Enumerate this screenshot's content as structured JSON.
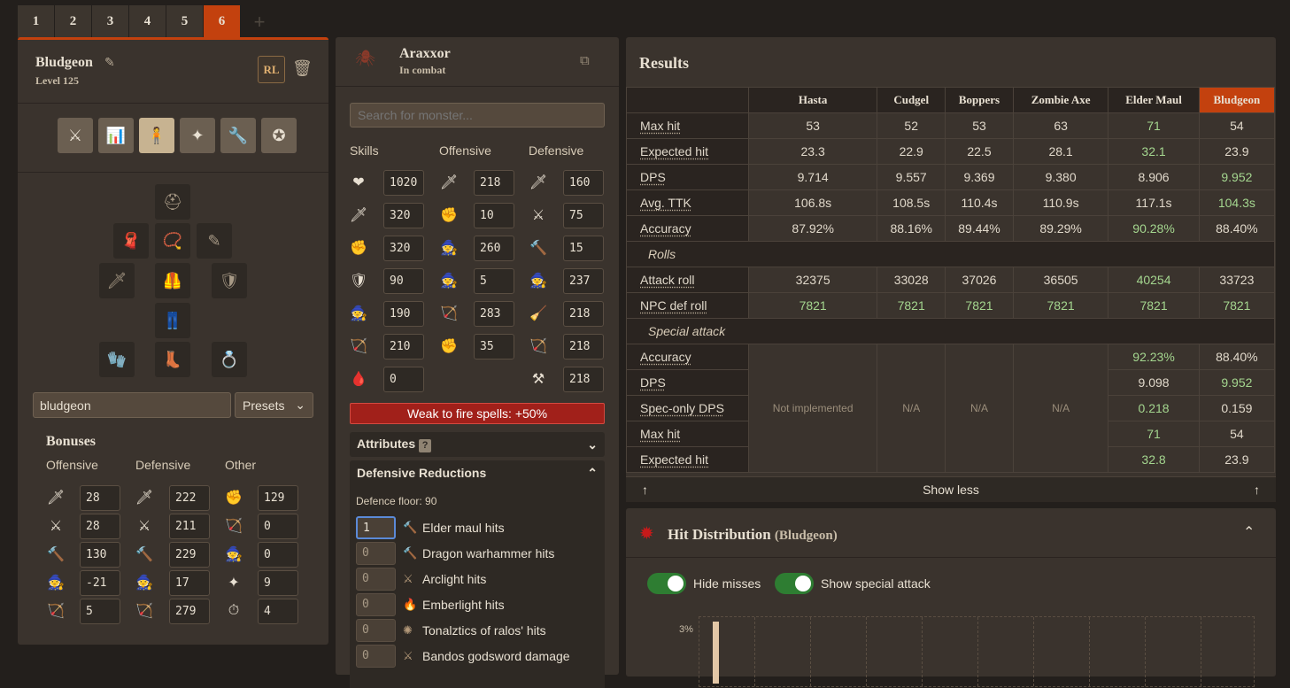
{
  "tabs": [
    "1",
    "2",
    "3",
    "4",
    "5",
    "6"
  ],
  "active_tab": "6",
  "tab_add": "+",
  "loadout": {
    "name": "Bludgeon",
    "level": "Level 125",
    "rl_label": "RL",
    "icons": [
      "combat-styles-icon",
      "skills-icon",
      "equipment-icon",
      "prayer-icon",
      "spanner-icon",
      "spellbook-icon"
    ],
    "search_value": "bludgeon",
    "presets_label": "Presets"
  },
  "bonuses": {
    "title": "Bonuses",
    "offensive_label": "Offensive",
    "defensive_label": "Defensive",
    "other_label": "Other",
    "offensive": [
      "28",
      "28",
      "130",
      "-21",
      "5"
    ],
    "defensive": [
      "222",
      "211",
      "229",
      "17",
      "279"
    ],
    "other": [
      "129",
      "0",
      "0",
      "9",
      "4"
    ]
  },
  "monster": {
    "name": "Araxxor",
    "status": "In combat",
    "search_placeholder": "Search for monster...",
    "skills_label": "Skills",
    "offensive_label": "Offensive",
    "defensive_label": "Defensive",
    "skills": [
      "1020",
      "320",
      "320",
      "90",
      "190",
      "210",
      "0"
    ],
    "offensive": [
      "218",
      "10",
      "260",
      "5",
      "283",
      "35"
    ],
    "defensive": [
      "160",
      "75",
      "15",
      "237",
      "218",
      "218",
      "218"
    ],
    "weakness": "Weak to fire spells: +50%",
    "attributes_label": "Attributes",
    "attributes_q": "?",
    "defred_label": "Defensive Reductions",
    "defence_floor": "Defence floor: 90",
    "reductions": [
      {
        "value": "1",
        "label": "Elder maul hits"
      },
      {
        "value": "0",
        "label": "Dragon warhammer hits"
      },
      {
        "value": "0",
        "label": "Arclight hits"
      },
      {
        "value": "0",
        "label": "Emberlight hits"
      },
      {
        "value": "0",
        "label": "Tonalztics of ralos' hits"
      },
      {
        "value": "0",
        "label": "Bandos godsword damage"
      }
    ]
  },
  "results": {
    "title": "Results",
    "columns": [
      "Hasta",
      "Cudgel",
      "Boppers",
      "Zombie Axe",
      "Elder Maul",
      "Bludgeon"
    ],
    "rows": [
      {
        "label": "Max hit",
        "values": [
          "53",
          "52",
          "53",
          "63",
          "71",
          "54"
        ]
      },
      {
        "label": "Expected hit",
        "values": [
          "23.3",
          "22.9",
          "22.5",
          "28.1",
          "32.1",
          "23.9"
        ]
      },
      {
        "label": "DPS",
        "values": [
          "9.714",
          "9.557",
          "9.369",
          "9.380",
          "8.906",
          "9.952"
        ]
      },
      {
        "label": "Avg. TTK",
        "values": [
          "106.8s",
          "108.5s",
          "110.4s",
          "110.9s",
          "117.1s",
          "104.3s"
        ]
      },
      {
        "label": "Accuracy",
        "values": [
          "87.92%",
          "88.16%",
          "89.44%",
          "89.29%",
          "90.28%",
          "88.40%"
        ]
      }
    ],
    "rolls_label": "Rolls",
    "roll_rows": [
      {
        "label": "Attack roll",
        "values": [
          "32375",
          "33028",
          "37026",
          "36505",
          "40254",
          "33723"
        ]
      },
      {
        "label": "NPC def roll",
        "values": [
          "7821",
          "7821",
          "7821",
          "7821",
          "7821",
          "7821"
        ]
      }
    ],
    "spec_label": "Special attack",
    "spec_rows": [
      {
        "label": "Accuracy",
        "values": [
          "92.23%",
          "88.40%"
        ]
      },
      {
        "label": "DPS",
        "values": [
          "9.098",
          "9.952"
        ]
      },
      {
        "label": "Spec-only DPS",
        "values": [
          "0.218",
          "0.159"
        ]
      },
      {
        "label": "Max hit",
        "values": [
          "71",
          "54"
        ]
      },
      {
        "label": "Expected hit",
        "values": [
          "32.8",
          "23.9"
        ]
      }
    ],
    "not_implemented": "Not implemented",
    "na": "N/A",
    "show_less": "Show less"
  },
  "hit_distribution": {
    "title": "Hit Distribution",
    "subtitle": "(Bludgeon)",
    "hide_misses": "Hide misses",
    "show_special": "Show special attack",
    "y_tick": "3%"
  },
  "colors": {
    "accent": "#c3410e",
    "good": "#a4d68f",
    "weak": "#a1201a"
  }
}
